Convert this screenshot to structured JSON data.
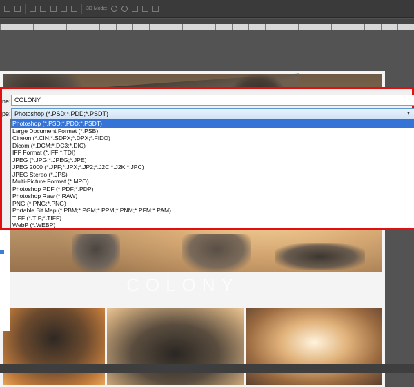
{
  "toolbar": {
    "icons": [
      "align-left-icon",
      "align-center-icon",
      "align-right-icon",
      "align-top-icon",
      "align-middle-icon",
      "align-bottom-icon",
      "distribute-icon",
      "3d-mode-label",
      "rotate-icon",
      "pan-icon",
      "move-icon",
      "slide-icon",
      "scale-icon"
    ],
    "mode_label": "3D Mode:"
  },
  "dialog": {
    "name_label": "ne:",
    "type_label": "pe:",
    "file_name": "COLONY",
    "selected_format": "Photoshop (*.PSD;*.PDD;*.PSDT)",
    "accent_color": "#e01010",
    "selection_color": "#3574d6",
    "formats": [
      "Photoshop (*.PSD;*.PDD;*.PSDT)",
      "Large Document Format (*.PSB)",
      "Cineon (*.CIN;*.SDPX;*.DPX;*.FIDO)",
      "Dicom (*.DCM;*.DC3;*.DIC)",
      "IFF Format (*.IFF;*.TDI)",
      "JPEG (*.JPG;*.JPEG;*.JPE)",
      "JPEG 2000 (*.JPF;*.JPX;*.JP2;*.J2C;*.J2K;*.JPC)",
      "JPEG Stereo (*.JPS)",
      "Multi-Picture Format (*.MPO)",
      "Photoshop PDF (*.PDF;*.PDP)",
      "Photoshop Raw (*.RAW)",
      "PNG (*.PNG;*.PNG)",
      "Portable Bit Map (*.PBM;*.PGM;*.PPM;*.PNM;*.PFM;*.PAM)",
      "TIFF (*.TIF;*.TIFF)",
      "WebP (*.WEBP)"
    ]
  },
  "artboard": {
    "title": "COLONY"
  }
}
